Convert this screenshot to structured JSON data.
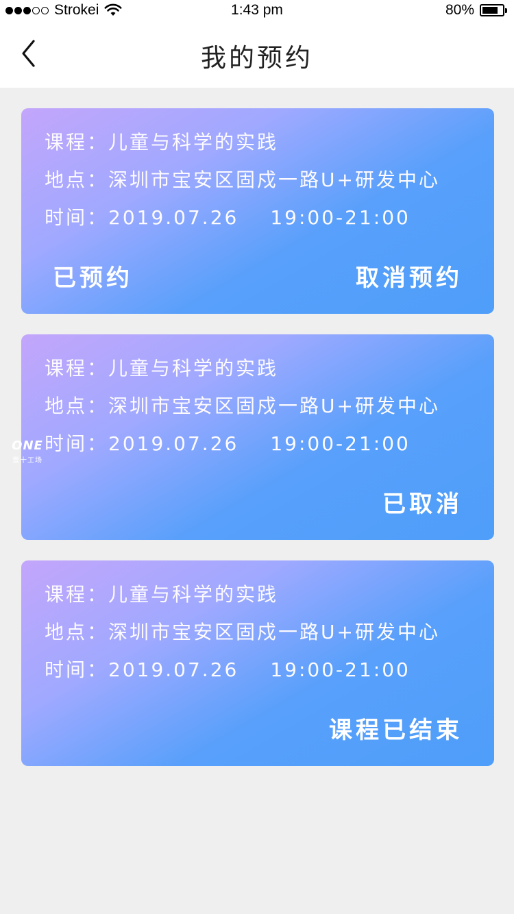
{
  "status_bar": {
    "carrier": "Strokei",
    "time": "1:43 pm",
    "battery_percent": "80%",
    "battery_level": 0.8,
    "signal_bars": 3,
    "signal_total": 5
  },
  "nav": {
    "title": "我的预约",
    "back_icon": "chevron-left-icon"
  },
  "bookings": [
    {
      "course_label": "课程：",
      "course": "儿童与科学的实践",
      "place_label": "地点：",
      "place": "深圳市宝安区固戍一路U+研发中心",
      "time_label": "时间：",
      "date": "2019.07.26",
      "hours": "19:00-21:00",
      "status": "已预约",
      "action": "取消预约"
    },
    {
      "course_label": "课程：",
      "course": "儿童与科学的实践",
      "place_label": "地点：",
      "place": "深圳市宝安区固戍一路U+研发中心",
      "time_label": "时间：",
      "date": "2019.07.26",
      "hours": "19:00-21:00",
      "status": "已取消"
    },
    {
      "course_label": "课程：",
      "course": "儿童与科学的实践",
      "place_label": "地点：",
      "place": "深圳市宝安区固戍一路U+研发中心",
      "time_label": "时间：",
      "date": "2019.07.26",
      "hours": "19:00-21:00",
      "status": "课程已结束"
    }
  ],
  "watermark": {
    "logo": "ONE",
    "sub": "壹十工场"
  },
  "colors": {
    "card_gradient_start": "#c3a6fb",
    "card_gradient_end": "#4e9efa",
    "page_background": "#efefef"
  }
}
